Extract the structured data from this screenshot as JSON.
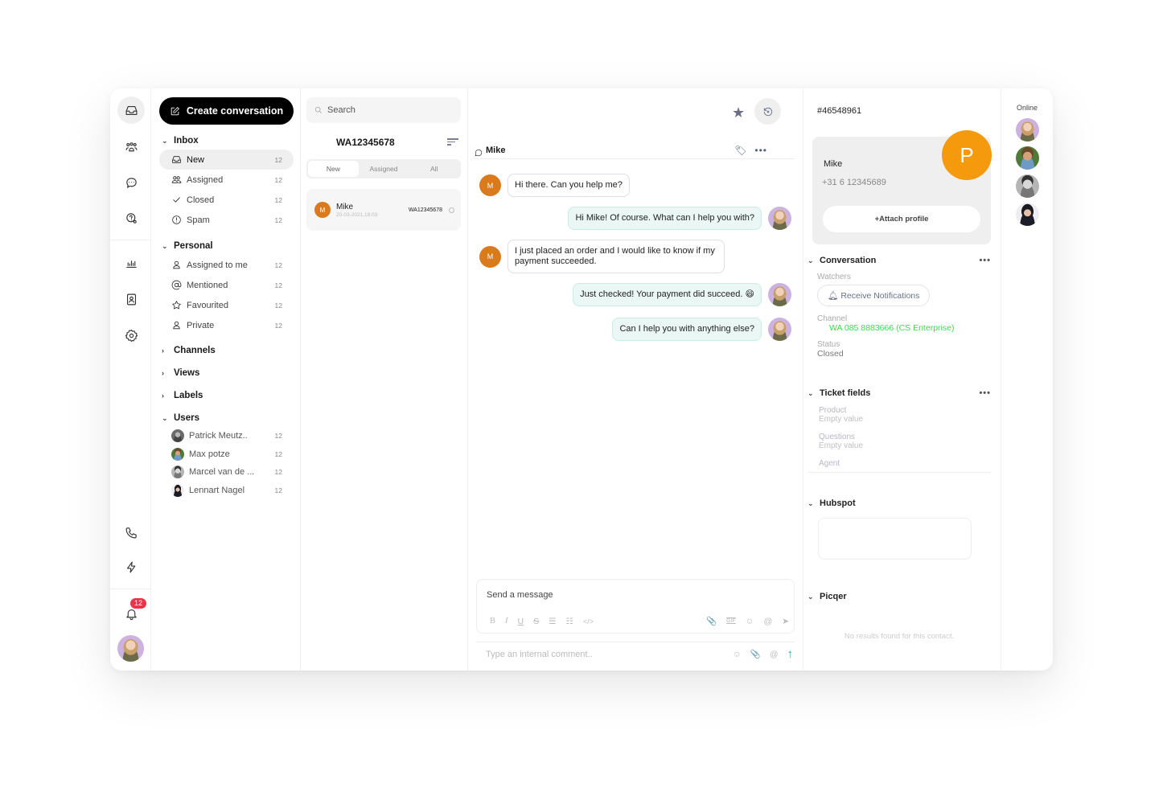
{
  "rail": {
    "icons": [
      "inbox-icon",
      "team-icon",
      "sms-icon",
      "help-settings-icon",
      "reports-icon",
      "contacts-icon",
      "settings-icon",
      "phone-icon",
      "automation-icon",
      "bell-icon"
    ],
    "notification_count": "12"
  },
  "sidebar": {
    "create_label": "Create conversation",
    "inbox": {
      "title": "Inbox",
      "items": [
        {
          "label": "New",
          "count": "12",
          "icon": "inbox-icon"
        },
        {
          "label": "Assigned",
          "count": "12",
          "icon": "users-icon"
        },
        {
          "label": "Closed",
          "count": "12",
          "icon": "check-icon"
        },
        {
          "label": "Spam",
          "count": "12",
          "icon": "alert-icon"
        }
      ]
    },
    "personal": {
      "title": "Personal",
      "items": [
        {
          "label": "Assigned to me",
          "count": "12",
          "icon": "user-icon"
        },
        {
          "label": "Mentioned",
          "count": "12",
          "icon": "at-icon"
        },
        {
          "label": "Favourited",
          "count": "12",
          "icon": "star-icon"
        },
        {
          "label": "Private",
          "count": "12",
          "icon": "user-icon"
        }
      ]
    },
    "channels": {
      "title": "Channels"
    },
    "views": {
      "title": "Views"
    },
    "labels": {
      "title": "Labels"
    },
    "users": {
      "title": "Users",
      "items": [
        {
          "label": "Patrick Meutz..",
          "count": "12"
        },
        {
          "label": "Max potze",
          "count": "12"
        },
        {
          "label": "Marcel van de ...",
          "count": "12"
        },
        {
          "label": "Lennart Nagel",
          "count": "12"
        }
      ]
    }
  },
  "convlist": {
    "search_placeholder": "Search",
    "title": "WA12345678",
    "tabs": [
      "New",
      "Assigned",
      "All"
    ],
    "active_tab": "New",
    "conversations": [
      {
        "initial": "M",
        "name": "Mike",
        "date": "20-03-2021,18:03",
        "id": "WA12345678",
        "channel": "whatsapp"
      }
    ]
  },
  "chat": {
    "contact_name": "Mike",
    "contact_initial": "M",
    "messages": [
      {
        "direction": "in",
        "text": "Hi there. Can you help me?"
      },
      {
        "direction": "out",
        "text": "Hi Mike! Of course. What can I help you with?"
      },
      {
        "direction": "in",
        "text": "I just placed an order and I would like to know if my payment succeeded."
      },
      {
        "direction": "out",
        "text": "Just checked! Your payment did succeed. 😄"
      },
      {
        "direction": "out",
        "text": "Can I help you with anything else?"
      }
    ],
    "composer_placeholder": "Send a message",
    "comment_placeholder": "Type an internal comment..",
    "accent_color": "#19b39b"
  },
  "details": {
    "ticket_id": "#46548961",
    "contact": {
      "name": "Mike",
      "phone": "+31 6 12345689",
      "avatar_initial": "P",
      "attach_label": "+Attach profile"
    },
    "conversation": {
      "title": "Conversation",
      "watchers_label": "Watchers",
      "notify_label": "Receive Notifications",
      "channel_label": "Channel",
      "channel_value": "WA 085 8883666 (CS Enterprise)",
      "status_label": "Status",
      "status_value": "Closed"
    },
    "ticket_fields": {
      "title": "Ticket fields",
      "fields": [
        {
          "label": "Product",
          "value": "Empty value"
        },
        {
          "label": "Questions",
          "value": "Empty value"
        },
        {
          "label": "Agent",
          "value": ""
        }
      ]
    },
    "hubspot": {
      "title": "Hubspot"
    },
    "picqer": {
      "title": "Picqer",
      "empty": "No results found for this contact."
    }
  },
  "online": {
    "title": "Online",
    "count": 4
  }
}
